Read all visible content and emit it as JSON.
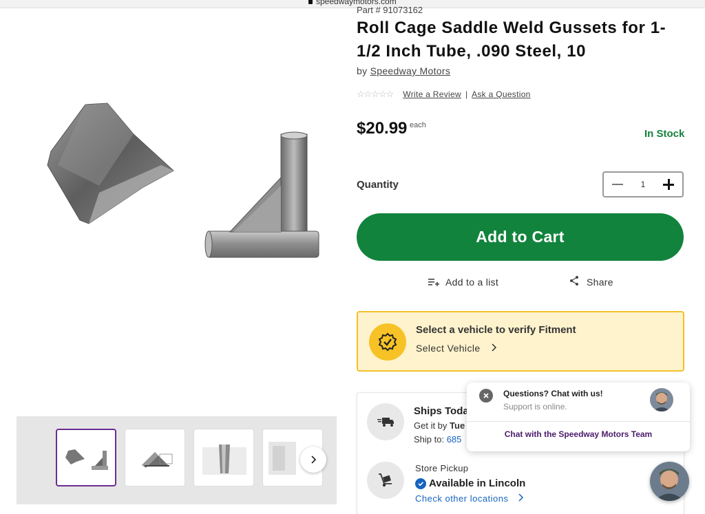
{
  "browser": {
    "url": "speedwaymotors.com"
  },
  "product": {
    "part_number": "Part # 91073162",
    "title": "Roll Cage Saddle Weld Gussets for 1-1/2 Inch Tube, .090 Steel, 10",
    "by_prefix": "by",
    "brand": "Speedway Motors",
    "stars": "☆☆☆☆☆",
    "write_review": "Write a Review",
    "separator": "|",
    "ask_question": "Ask a Question",
    "price": "$20.99",
    "price_unit": "each",
    "stock_status": "In Stock",
    "quantity_label": "Quantity",
    "quantity_value": "1",
    "add_to_cart": "Add to Cart",
    "add_to_list": "Add to a list",
    "share": "Share"
  },
  "fitment": {
    "title": "Select a vehicle to verify Fitment",
    "link": "Select Vehicle"
  },
  "shipping": {
    "title": "Ships Toda",
    "get_it_prefix": "Get it by ",
    "get_it_day": "Tue",
    "ship_to_prefix": "Ship to: ",
    "ship_to_zip": "685",
    "pickup_label": "Store Pickup",
    "pickup_available": "Available in Lincoln",
    "other_locations": "Check other locations"
  },
  "chat": {
    "title": "Questions? Chat with us!",
    "status": "Support is online.",
    "team_link": "Chat with the Speedway Motors Team"
  },
  "colors": {
    "brand_green": "#12833d",
    "stock_green": "#14803c",
    "accent_purple": "#6b2c91",
    "fitment_yellow": "#f6c226",
    "link_blue": "#1565c0"
  }
}
